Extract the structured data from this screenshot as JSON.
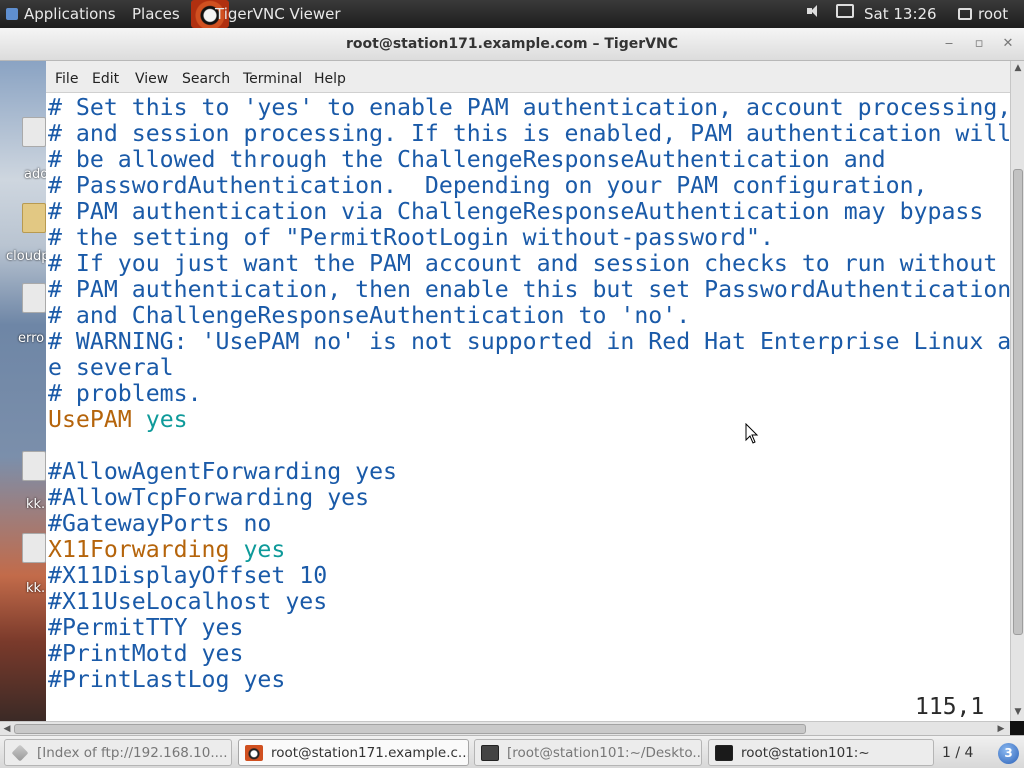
{
  "top_panel": {
    "applications": "Applications",
    "places": "Places",
    "vnc_task": "TigerVNC Viewer",
    "clock": "Sat 13:26",
    "user": "root"
  },
  "window": {
    "title": "root@station171.example.com – TigerVNC",
    "controls": {
      "minimize": "‒",
      "maximize": "▫",
      "close": "✕"
    }
  },
  "desktop_icons": [
    "ado",
    "cloudp",
    "erro",
    "kk.",
    "kk."
  ],
  "menubar": [
    "File",
    "Edit",
    "View",
    "Search",
    "Terminal",
    "Help"
  ],
  "terminal_lines": [
    {
      "type": "comment",
      "text": "# Set this to 'yes' to enable PAM authentication, account processing,"
    },
    {
      "type": "comment",
      "text": "# and session processing. If this is enabled, PAM authentication will"
    },
    {
      "type": "comment",
      "text": "# be allowed through the ChallengeResponseAuthentication and"
    },
    {
      "type": "comment",
      "text": "# PasswordAuthentication.  Depending on your PAM configuration,"
    },
    {
      "type": "comment",
      "text": "# PAM authentication via ChallengeResponseAuthentication may bypass"
    },
    {
      "type": "comment",
      "text": "# the setting of \"PermitRootLogin without-password\"."
    },
    {
      "type": "comment",
      "text": "# If you just want the PAM account and session checks to run without"
    },
    {
      "type": "comment",
      "text": "# PAM authentication, then enable this but set PasswordAuthentication"
    },
    {
      "type": "comment",
      "text": "# and ChallengeResponseAuthentication to 'no'."
    },
    {
      "type": "comment",
      "text": "# WARNING: 'UsePAM no' is not supported in Red Hat Enterprise Linux a"
    },
    {
      "type": "comment",
      "text": "e several"
    },
    {
      "type": "comment",
      "text": "# problems."
    },
    {
      "type": "directive",
      "key": "UsePAM",
      "value": "yes"
    },
    {
      "type": "blank",
      "text": ""
    },
    {
      "type": "comment",
      "text": "#AllowAgentForwarding yes"
    },
    {
      "type": "comment",
      "text": "#AllowTcpForwarding yes"
    },
    {
      "type": "comment",
      "text": "#GatewayPorts no"
    },
    {
      "type": "directive",
      "key": "X11Forwarding",
      "value": "yes"
    },
    {
      "type": "comment",
      "text": "#X11DisplayOffset 10"
    },
    {
      "type": "comment",
      "text": "#X11UseLocalhost yes"
    },
    {
      "type": "comment",
      "text": "#PermitTTY yes"
    },
    {
      "type": "comment",
      "text": "#PrintMotd yes"
    },
    {
      "type": "comment",
      "text": "#PrintLastLog yes"
    }
  ],
  "status": {
    "cursor_position": "115,1"
  },
  "taskbar": {
    "tasks": [
      {
        "label": "[Index of ftp://192.168.10....",
        "icon": "ftp-icon",
        "state": "dim"
      },
      {
        "label": "root@station171.example.c...",
        "icon": "vnc-icon",
        "state": "active"
      },
      {
        "label": "[root@station101:~/Deskto...",
        "icon": "terminal-icon",
        "state": "dim"
      },
      {
        "label": "root@station101:~",
        "icon": "terminal-icon",
        "state": "normal"
      }
    ],
    "workspace": "1 / 4",
    "notifications": "3"
  },
  "colors": {
    "comment": "#1a5aa8",
    "keyword": "#b5640b",
    "value": "#0e9a9a"
  }
}
